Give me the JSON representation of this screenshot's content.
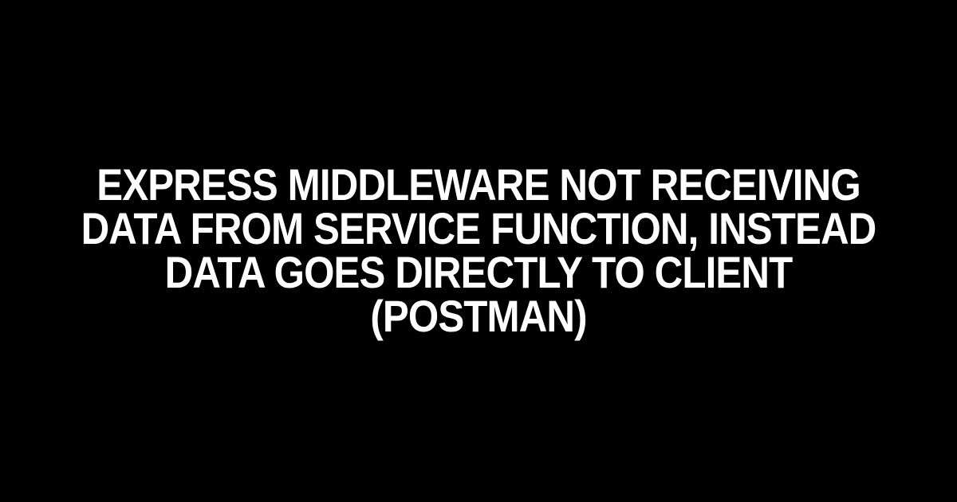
{
  "title": "EXPRESS MIDDLEWARE NOT RECEIVING DATA FROM SERVICE FUNCTION, INSTEAD DATA GOES DIRECTLY TO CLIENT (POSTMAN)"
}
